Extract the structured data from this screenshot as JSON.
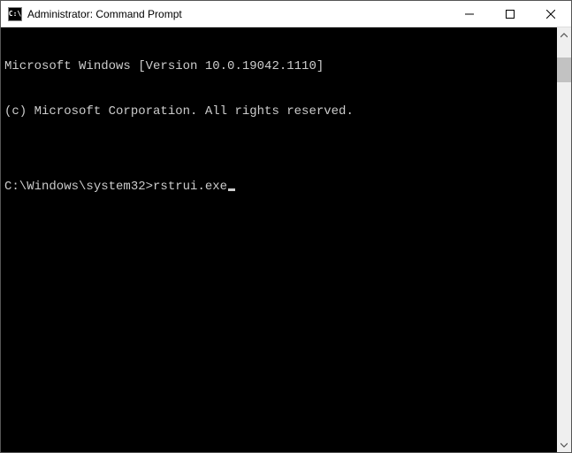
{
  "window": {
    "title": "Administrator: Command Prompt",
    "icon_label": "C:\\"
  },
  "terminal": {
    "line1": "Microsoft Windows [Version 10.0.19042.1110]",
    "line2": "(c) Microsoft Corporation. All rights reserved.",
    "blank": "",
    "prompt": "C:\\Windows\\system32>",
    "command": "rstrui.exe"
  },
  "colors": {
    "terminal_bg": "#000000",
    "terminal_fg": "#cccccc",
    "titlebar_bg": "#ffffff"
  }
}
